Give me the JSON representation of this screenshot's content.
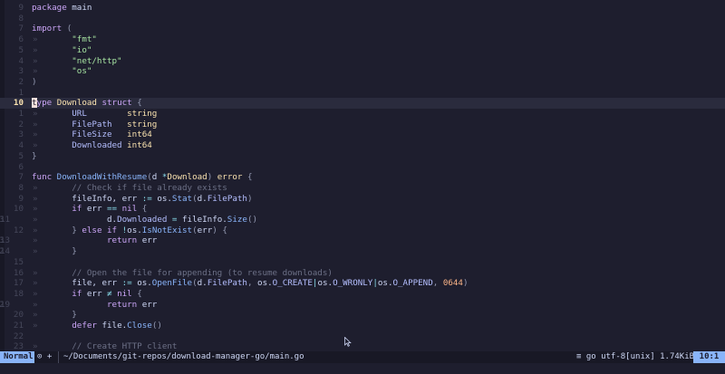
{
  "editor": {
    "lines": [
      {
        "ln": "9",
        "cls": "",
        "seg": [
          [
            "kw",
            "package"
          ],
          [
            "id",
            " main"
          ]
        ]
      },
      {
        "ln": "8",
        "cls": "",
        "seg": []
      },
      {
        "ln": "7",
        "cls": "",
        "seg": [
          [
            "kw",
            "import"
          ],
          [
            "pu",
            " ("
          ]
        ]
      },
      {
        "ln": "6",
        "cls": "",
        "ind": "»",
        "seg": [
          [
            "id",
            "        "
          ],
          [
            "str",
            "\"fmt\""
          ]
        ]
      },
      {
        "ln": "5",
        "cls": "",
        "ind": "»",
        "seg": [
          [
            "id",
            "        "
          ],
          [
            "str",
            "\"io\""
          ]
        ]
      },
      {
        "ln": "4",
        "cls": "",
        "ind": "»",
        "seg": [
          [
            "id",
            "        "
          ],
          [
            "str",
            "\"net/http\""
          ]
        ]
      },
      {
        "ln": "3",
        "cls": "",
        "ind": "»",
        "seg": [
          [
            "id",
            "        "
          ],
          [
            "str",
            "\"os\""
          ]
        ]
      },
      {
        "ln": "2",
        "cls": "",
        "seg": [
          [
            "pu",
            ")"
          ]
        ]
      },
      {
        "ln": "1",
        "cls": "",
        "seg": []
      },
      {
        "ln": "10",
        "cls": "cur",
        "seg": [
          [
            "cursor",
            "t"
          ],
          [
            "kw",
            "ype"
          ],
          [
            "ty",
            " Download"
          ],
          [
            "kw",
            " struct"
          ],
          [
            "pu",
            " {"
          ]
        ]
      },
      {
        "ln": "1",
        "cls": "",
        "ind": "»",
        "seg": [
          [
            "id",
            "        "
          ],
          [
            "fd",
            "URL"
          ],
          [
            "id",
            "        "
          ],
          [
            "ty",
            "string"
          ]
        ]
      },
      {
        "ln": "2",
        "cls": "",
        "ind": "»",
        "seg": [
          [
            "id",
            "        "
          ],
          [
            "fd",
            "FilePath"
          ],
          [
            "id",
            "   "
          ],
          [
            "ty",
            "string"
          ]
        ]
      },
      {
        "ln": "3",
        "cls": "",
        "ind": "»",
        "seg": [
          [
            "id",
            "        "
          ],
          [
            "fd",
            "FileSize"
          ],
          [
            "id",
            "   "
          ],
          [
            "ty",
            "int64"
          ]
        ]
      },
      {
        "ln": "4",
        "cls": "",
        "ind": "»",
        "seg": [
          [
            "id",
            "        "
          ],
          [
            "fd",
            "Downloaded"
          ],
          [
            "id",
            " "
          ],
          [
            "ty",
            "int64"
          ]
        ]
      },
      {
        "ln": "5",
        "cls": "",
        "seg": [
          [
            "pu",
            "}"
          ]
        ]
      },
      {
        "ln": "6",
        "cls": "",
        "seg": []
      },
      {
        "ln": "7",
        "cls": "",
        "seg": [
          [
            "kw",
            "func"
          ],
          [
            "fn",
            " DownloadWithResume"
          ],
          [
            "pu",
            "("
          ],
          [
            "id",
            "d "
          ],
          [
            "op",
            "*"
          ],
          [
            "ty",
            "Download"
          ],
          [
            "pu",
            ")"
          ],
          [
            "ty",
            " error"
          ],
          [
            "pu",
            " {"
          ]
        ]
      },
      {
        "ln": "8",
        "cls": "",
        "ind": "»",
        "seg": [
          [
            "id",
            "        "
          ],
          [
            "cm",
            "// Check if file already exists"
          ]
        ]
      },
      {
        "ln": "9",
        "cls": "",
        "ind": "»",
        "seg": [
          [
            "id",
            "        fileInfo, err "
          ],
          [
            "op",
            ":="
          ],
          [
            "id",
            " os."
          ],
          [
            "fn",
            "Stat"
          ],
          [
            "pu",
            "("
          ],
          [
            "id",
            "d."
          ],
          [
            "fd",
            "FilePath"
          ],
          [
            "pu",
            ")"
          ]
        ]
      },
      {
        "ln": "10",
        "cls": "",
        "ind": "»",
        "seg": [
          [
            "id",
            "        "
          ],
          [
            "kw",
            "if"
          ],
          [
            "id",
            " err "
          ],
          [
            "op",
            "=="
          ],
          [
            "kw",
            " nil"
          ],
          [
            "pu",
            " {"
          ]
        ]
      },
      {
        "ln": "3",
        "cls": "wrap",
        "ln2": "11",
        "ind": "»",
        "seg": [
          [
            "id",
            "        "
          ],
          [
            "id",
            "       d."
          ],
          [
            "fd",
            "Downloaded"
          ],
          [
            "op",
            " ="
          ],
          [
            "id",
            " fileInfo."
          ],
          [
            "fn",
            "Size"
          ],
          [
            "pu",
            "()"
          ]
        ]
      },
      {
        "ln": "12",
        "cls": "",
        "ind": "»",
        "seg": [
          [
            "id",
            "        "
          ],
          [
            "pu",
            "}"
          ],
          [
            "kw",
            " else if"
          ],
          [
            "op",
            " !"
          ],
          [
            "id",
            "os."
          ],
          [
            "fn",
            "IsNotExist"
          ],
          [
            "pu",
            "("
          ],
          [
            "id",
            "err"
          ],
          [
            "pu",
            ")"
          ],
          [
            "pu",
            " {"
          ]
        ]
      },
      {
        "ln": "3",
        "cls": "wrap",
        "ln2": "13",
        "ind": "»",
        "seg": [
          [
            "id",
            "        "
          ],
          [
            "kw",
            "       return"
          ],
          [
            "id",
            " err"
          ]
        ]
      },
      {
        "ln": "2",
        "cls": "wrap",
        "ln2": "14",
        "ind": "»",
        "seg": [
          [
            "id",
            "        "
          ],
          [
            "pu",
            "}"
          ]
        ]
      },
      {
        "ln": "15",
        "cls": "",
        "seg": []
      },
      {
        "ln": "16",
        "cls": "",
        "ind": "»",
        "seg": [
          [
            "id",
            "        "
          ],
          [
            "cm",
            "// Open the file for appending (to resume downloads)"
          ]
        ]
      },
      {
        "ln": "17",
        "cls": "",
        "ind": "»",
        "seg": [
          [
            "id",
            "        file, err "
          ],
          [
            "op",
            ":="
          ],
          [
            "id",
            " os."
          ],
          [
            "fn",
            "OpenFile"
          ],
          [
            "pu",
            "("
          ],
          [
            "id",
            "d."
          ],
          [
            "fd",
            "FilePath"
          ],
          [
            "pu",
            ", "
          ],
          [
            "id",
            "os."
          ],
          [
            "fd",
            "O_CREATE"
          ],
          [
            "op",
            "|"
          ],
          [
            "id",
            "os."
          ],
          [
            "fd",
            "O_WRONLY"
          ],
          [
            "op",
            "|"
          ],
          [
            "id",
            "os."
          ],
          [
            "fd",
            "O_APPEND"
          ],
          [
            "pu",
            ", "
          ],
          [
            "num",
            "0644"
          ],
          [
            "pu",
            ")"
          ]
        ]
      },
      {
        "ln": "18",
        "cls": "",
        "ind": "»",
        "seg": [
          [
            "id",
            "        "
          ],
          [
            "kw",
            "if"
          ],
          [
            "id",
            " err "
          ],
          [
            "op",
            "≠"
          ],
          [
            "kw",
            " nil"
          ],
          [
            "pu",
            " {"
          ]
        ]
      },
      {
        "ln": "2",
        "cls": "wrap",
        "ln2": "19",
        "ind": "»",
        "seg": [
          [
            "id",
            "        "
          ],
          [
            "kw",
            "       return"
          ],
          [
            "id",
            " err"
          ]
        ]
      },
      {
        "ln": "20",
        "cls": "",
        "ind": "»",
        "seg": [
          [
            "id",
            "        "
          ],
          [
            "pu",
            "}"
          ]
        ]
      },
      {
        "ln": "21",
        "cls": "",
        "ind": "»",
        "seg": [
          [
            "id",
            "        "
          ],
          [
            "kw",
            "defer"
          ],
          [
            "id",
            " file."
          ],
          [
            "fn",
            "Close"
          ],
          [
            "pu",
            "()"
          ]
        ]
      },
      {
        "ln": "22",
        "cls": "",
        "seg": []
      },
      {
        "ln": "23",
        "cls": "",
        "ind": "»",
        "seg": [
          [
            "id",
            "        "
          ],
          [
            "cm",
            "// Create HTTP client"
          ]
        ]
      }
    ]
  },
  "statusbar": {
    "mode": "Normal",
    "git": "⊙ +",
    "filepath": "~/Documents/git-repos/download-manager-go/main.go",
    "fileinfo": "≡ go utf-8[unix] 1.74KiB",
    "position": "10:1"
  },
  "colors": {
    "background": "#1e1e2e",
    "accent": "#89b4fa",
    "keyword": "#cba6f7",
    "string": "#a6e3a1"
  }
}
